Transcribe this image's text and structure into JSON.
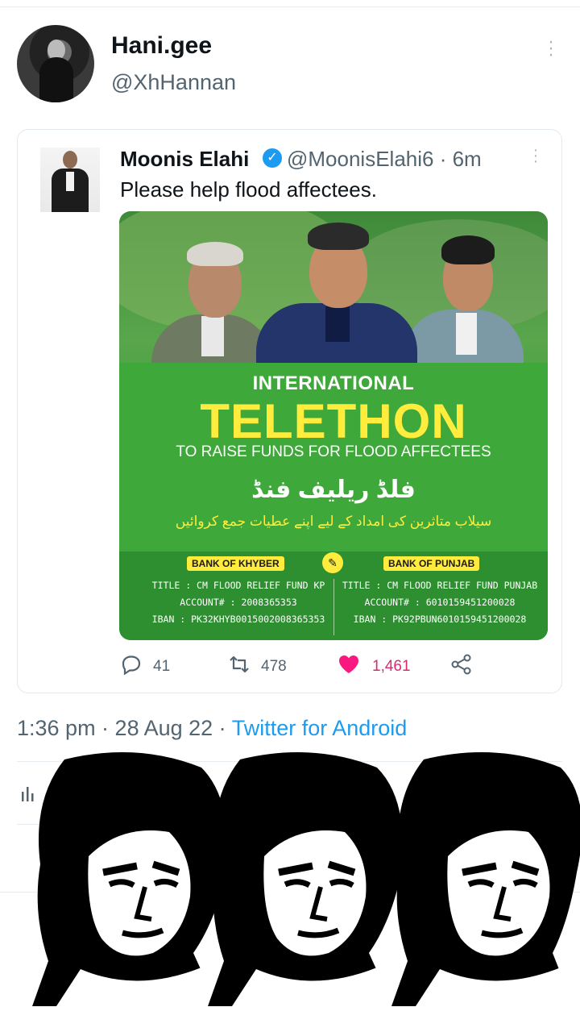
{
  "tweet": {
    "author_name": "Hani.gee",
    "author_handle": "@XhHannan",
    "timestamp": "1:36 pm · 28 Aug 22 · ",
    "client": "Twitter for Android"
  },
  "quoted": {
    "author_name": "Moonis Elahi",
    "author_handle": "@MoonisElahi6 · 6m",
    "text": "Please help flood affectees.",
    "poster": {
      "line1": "INTERNATIONAL",
      "line2": "TELETHON",
      "line3": "TO RAISE FUNDS FOR FLOOD AFFECTEES",
      "urdu_title": "فلڈ ریلیف فنڈ",
      "urdu_subtitle": "سیلاب متاثرین کی امداد کے لیے اپنے عطیات جمع کروائیں",
      "bank_left": {
        "name": "BANK OF KHYBER",
        "title": "TITLE : CM FLOOD RELIEF FUND KP",
        "account": "ACCOUNT# : 2008365353",
        "iban": "IBAN : PK32KHYB0015002008365353"
      },
      "bank_right": {
        "name": "BANK OF PUNJAB",
        "title": "TITLE : CM FLOOD RELIEF FUND PUNJAB",
        "account": "ACCOUNT# : 6010159451200028",
        "iban": "IBAN : PK92PBUN6010159451200028"
      }
    },
    "actions": {
      "replies": "41",
      "retweets": "478",
      "likes": "1,461"
    }
  },
  "colors": {
    "text_primary": "#0f1419",
    "text_secondary": "#536471",
    "link": "#1d9bf0",
    "like": "#d72c70",
    "poster_green": "#3fa83a",
    "poster_yellow": "#ffec3d"
  },
  "icons": [
    "reply-icon",
    "retweet-icon",
    "heart-icon",
    "share-icon",
    "verified-icon",
    "more-icon",
    "analytics-icon"
  ]
}
